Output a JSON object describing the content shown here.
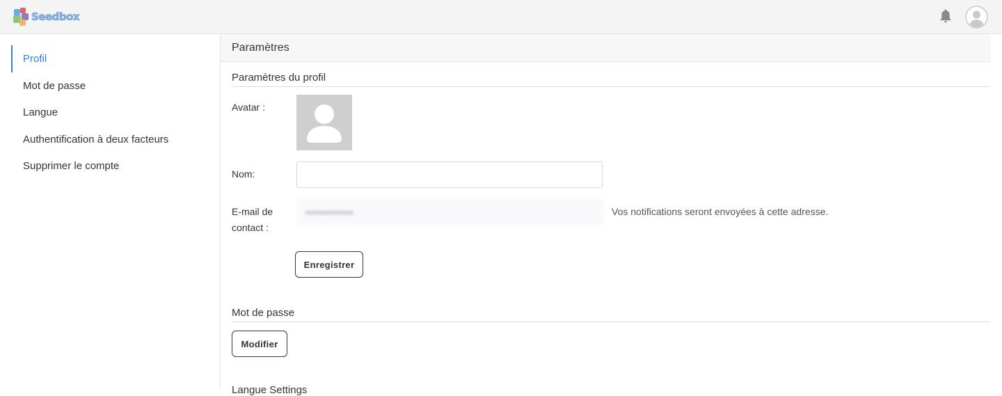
{
  "app": {
    "logo_text": "Seedbox",
    "logo_icon": "seedbox-logo-icon",
    "bell_icon": "bell-icon",
    "avatar_icon": "user-avatar-icon"
  },
  "sidebar": {
    "items": [
      {
        "label": "Profil",
        "active": true
      },
      {
        "label": "Mot de passe",
        "active": false
      },
      {
        "label": "Langue",
        "active": false
      },
      {
        "label": "Authentification à deux facteurs",
        "active": false
      },
      {
        "label": "Supprimer le compte",
        "active": false
      }
    ]
  },
  "main": {
    "header": "Paramètres",
    "profile_section": {
      "title": "Paramètres du profil",
      "avatar_label": "Avatar :",
      "name_label": "Nom:",
      "name_value": "",
      "email_label_line1": "E-mail de",
      "email_label_line2": "contact :",
      "email_value": "••••••••••••••",
      "email_hint": "Vos notifications seront envoyées à cette adresse.",
      "save_label": "Enregistrer"
    },
    "password_section": {
      "title": "Mot de passe",
      "modify_label": "Modifier"
    },
    "language_section": {
      "title": "Langue Settings"
    }
  },
  "colors": {
    "accent": "#2f80ed",
    "topbar_bg": "#f4f4f5",
    "avatar_placeholder_bg": "#cfcfcf"
  }
}
